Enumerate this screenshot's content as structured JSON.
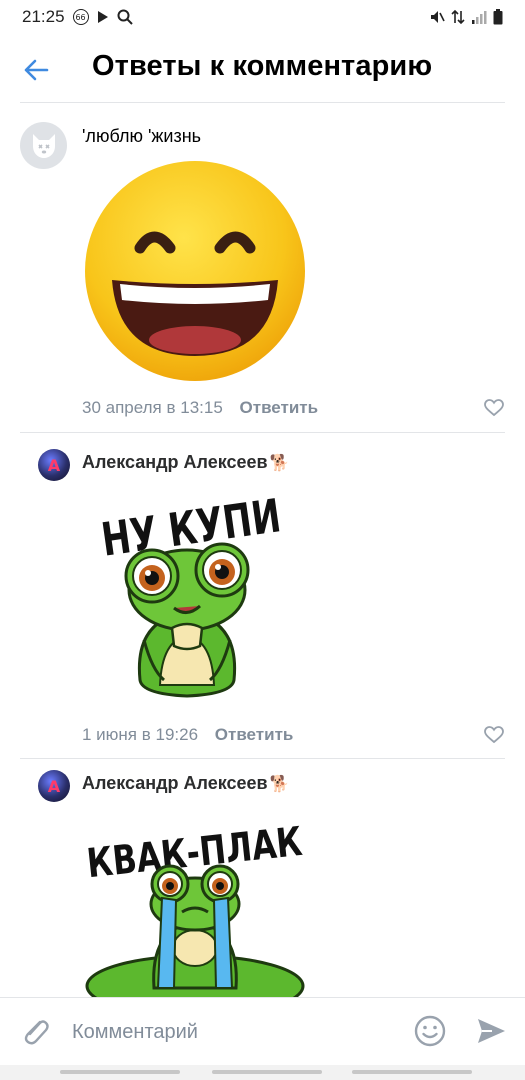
{
  "status_bar": {
    "time": "21:25",
    "badge": "66"
  },
  "header": {
    "title": "Ответы к комментарию"
  },
  "comments": [
    {
      "author": "'люблю 'жизнь",
      "sticker": "laughing-face-emoji",
      "date": "30 апреля в 13:15",
      "reply_label": "Ответить"
    },
    {
      "author": "Александр Алексеев",
      "author_badge": "🐕",
      "avatar_letter": "A",
      "sticker_text": "НУ КУПИ",
      "date": "1 июня в 19:26",
      "reply_label": "Ответить"
    },
    {
      "author": "Александр Алексеев",
      "author_badge": "🐕",
      "avatar_letter": "A",
      "sticker_text": "КВАК-ПЛАК"
    }
  ],
  "composer": {
    "placeholder": "Комментарий"
  },
  "colors": {
    "accent": "#3f8ae0",
    "secondary_text": "#818c99",
    "divider": "#e3e5e8",
    "frog_green": "#5cb82e",
    "emoji_yellow": "#f7c619"
  }
}
